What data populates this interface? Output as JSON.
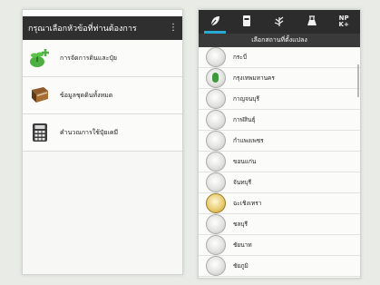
{
  "left_screen": {
    "title": "กรุณาเลือกหัวข้อที่ท่านต้องการ",
    "menu": [
      {
        "label": "การจัดการดินและปุ๋ย",
        "icon": "plant-fertilizer-icon"
      },
      {
        "label": "ข้อมูลชุดดินทั้งหมด",
        "icon": "book-icon"
      },
      {
        "label": "คำนวณการใช้ปุ๋ยเคมี",
        "icon": "calculator-icon"
      }
    ]
  },
  "right_screen": {
    "tabs": [
      {
        "icon": "leaf-map-icon",
        "active": true
      },
      {
        "icon": "sack-icon",
        "active": false
      },
      {
        "icon": "rice-plant-icon",
        "active": false
      },
      {
        "icon": "soil-test-icon",
        "active": false
      },
      {
        "icon": "npk-icon",
        "label": "NP K+",
        "active": false
      }
    ],
    "subtitle": "เลือกสถานที่ตั้งแปลง",
    "provinces": [
      "กระบี่",
      "กรุงเทพมหานคร",
      "กาญจนบุรี",
      "กาฬสินธุ์",
      "กำแพงเพชร",
      "ขอนแก่น",
      "จันทบุรี",
      "ฉะเชิงเทรา",
      "ชลบุรี",
      "ชัยนาท",
      "ชัยภูมิ"
    ]
  },
  "colors": {
    "appbar": "#2f2f2f",
    "tab_indicator": "#29a9d6",
    "icon_green": "#4caf3f"
  }
}
